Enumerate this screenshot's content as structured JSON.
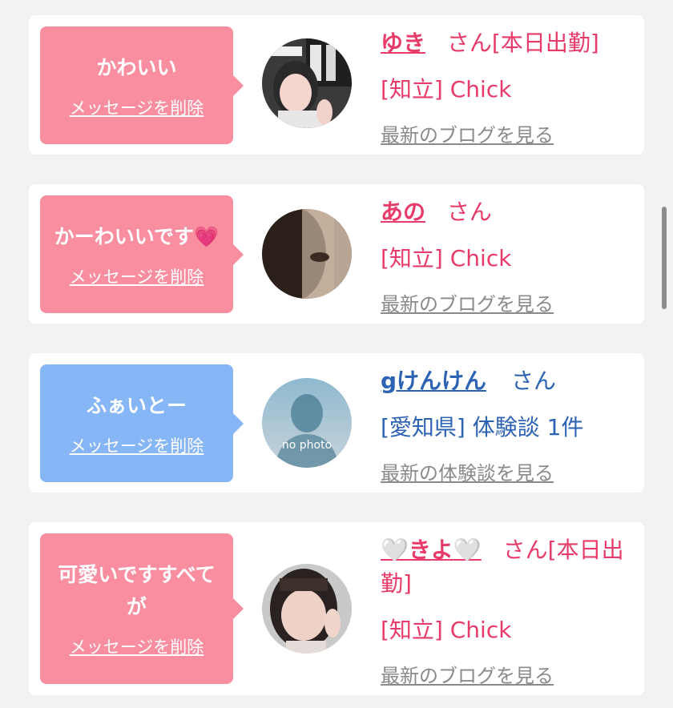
{
  "messages": [
    {
      "comment": "かわいい",
      "delete_label": "メッセージを削除",
      "name": "ゆき",
      "suffix": "さん[本日出勤]",
      "line2": "[知立] Chick",
      "link": "最新のブログを見る",
      "theme": "pink",
      "avatar_icon": "photo-avatar-icon"
    },
    {
      "comment": "かーわいいです",
      "comment_emoji": "💗",
      "delete_label": "メッセージを削除",
      "name": "あの",
      "suffix": "さん",
      "line2": "[知立] Chick",
      "link": "最新のブログを見る",
      "theme": "pink",
      "avatar_icon": "photo-avatar-icon"
    },
    {
      "comment": "ふぁいとー",
      "delete_label": "メッセージを削除",
      "name": "gけんけん",
      "suffix": "さん",
      "line2": "[愛知県] 体験談 1件",
      "link": "最新の体験談を見る",
      "theme": "blue",
      "avatar_icon": "no-photo-avatar-icon",
      "avatar_text": "no photo"
    },
    {
      "comment": "可愛いですすべてが",
      "delete_label": "メッセージを削除",
      "name_prefix": "🤍",
      "name": "きよ",
      "name_suffix": "🤍",
      "suffix": "さん[本日出勤]",
      "line2": "[知立] Chick",
      "link": "最新のブログを見る",
      "theme": "pink",
      "avatar_icon": "photo-avatar-icon"
    }
  ],
  "colors": {
    "background": "#f2f2f4",
    "pink_bubble": "#f98ea0",
    "blue_bubble": "#86b6f5",
    "pink_text": "#e83b69",
    "blue_text": "#2d63b3",
    "link_gray": "#8a8a8a"
  }
}
